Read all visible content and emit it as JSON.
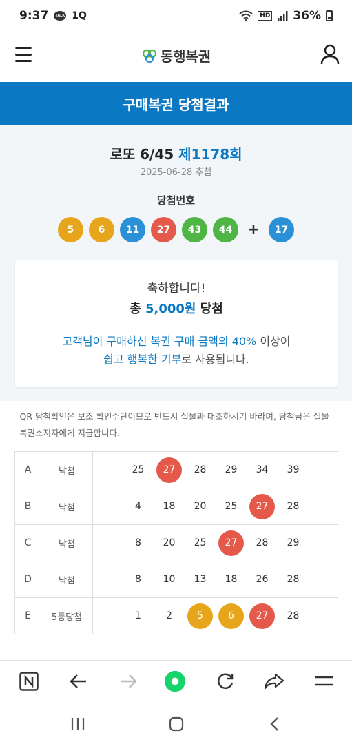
{
  "status_bar": {
    "time": "9:37",
    "talk_badge": "TALK",
    "carrier_icon": "1Q",
    "hd_badge": "HD",
    "battery": "36%"
  },
  "header": {
    "logo_text": "동행복권"
  },
  "title_band": {
    "title": "구매복권 당첨결과"
  },
  "draw": {
    "game_name": "로또 6/45",
    "draw_no": "제1178회",
    "date": "2025-06-28 추첨",
    "win_label": "당첨번호",
    "numbers": [
      "5",
      "6",
      "11",
      "27",
      "43",
      "44"
    ],
    "plus": "+",
    "bonus": "17"
  },
  "congrats": {
    "message": "축하합니다!",
    "prize_prefix": "총",
    "prize_amount": "5,000원",
    "prize_suffix": "당첨",
    "donate_line1_hl": "고객님이 구매하신 복권 구매 금액의 40%",
    "donate_line1_rest": "이상이",
    "donate_line2_hl": "쉽고 행복한 기부",
    "donate_line2_rest": "로 사용됩니다."
  },
  "notice": {
    "line1": "- QR 당첨확인은 보조 확인수단이므로 반드시 실물과 대조하시기 바라며, 당첨금은 실물",
    "line2": "복권소지자에게 지급합니다."
  },
  "tickets": [
    {
      "game": "A",
      "status": "낙첨",
      "numbers": [
        "25",
        "27",
        "28",
        "29",
        "34",
        "39"
      ]
    },
    {
      "game": "B",
      "status": "낙첨",
      "numbers": [
        "4",
        "18",
        "20",
        "25",
        "27",
        "28"
      ]
    },
    {
      "game": "C",
      "status": "낙첨",
      "numbers": [
        "8",
        "20",
        "25",
        "27",
        "28",
        "29"
      ]
    },
    {
      "game": "D",
      "status": "낙첨",
      "numbers": [
        "8",
        "10",
        "13",
        "18",
        "26",
        "28"
      ]
    },
    {
      "game": "E",
      "status": "5등당첨",
      "numbers": [
        "1",
        "2",
        "5",
        "6",
        "27",
        "28"
      ]
    }
  ],
  "colors": {
    "accent": "#0a78c2",
    "ball_yellow": "#e6a51b",
    "ball_blue": "#2a91d6",
    "ball_red": "#e4594a",
    "ball_green": "#4fb544",
    "ball_gray": "#aaaaaa"
  },
  "browser_bar": [
    "n-home-icon",
    "back-arrow-icon",
    "forward-arrow-icon",
    "green-record-icon",
    "reload-icon",
    "share-icon",
    "menu-icon"
  ],
  "system_nav": [
    "recent-apps-icon",
    "home-icon",
    "back-icon"
  ]
}
